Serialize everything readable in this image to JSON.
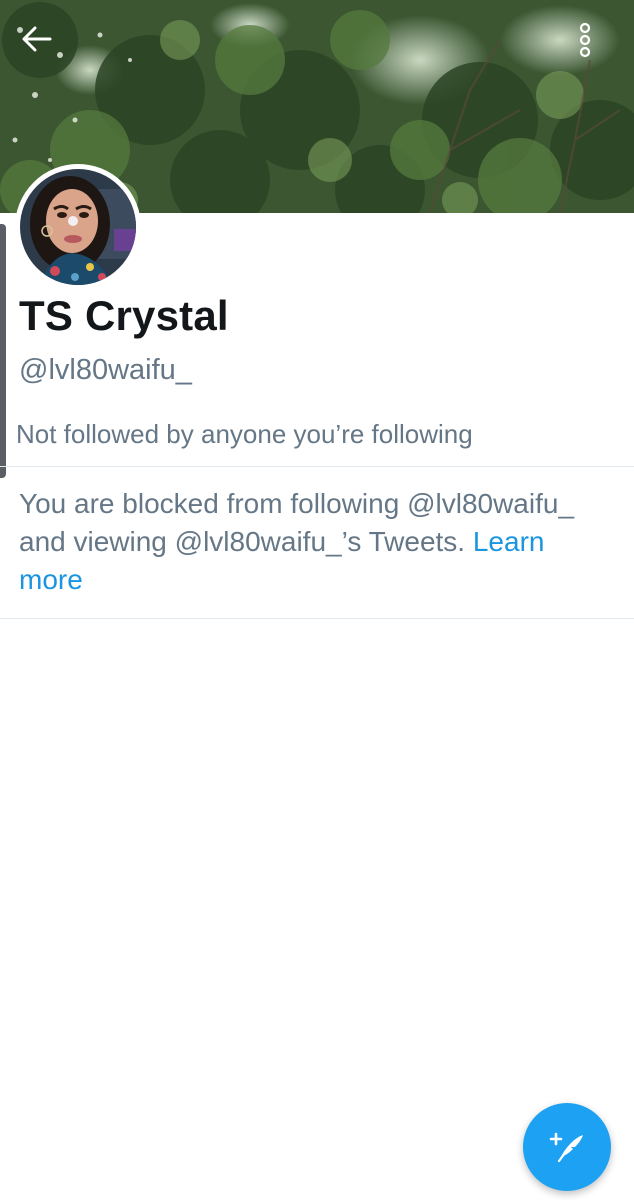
{
  "header": {
    "back_icon": "arrow-left-icon",
    "more_icon": "more-vertical-icon",
    "banner_image": "trees-banner"
  },
  "profile": {
    "display_name": "TS Crystal",
    "handle": "@lvl80waifu_",
    "followed_by_text": "Not followed by anyone you’re following"
  },
  "blocked_notice": {
    "text": "You are blocked from following @lvl80waifu_ and viewing @lvl80waifu_’s Tweets. ",
    "link_label": "Learn more"
  },
  "compose": {
    "icon": "compose-tweet-icon"
  },
  "colors": {
    "accent": "#1da1f2",
    "link": "#1b95e0",
    "primary_text": "#14171a",
    "secondary_text": "#657786",
    "divider": "#e1e8ed"
  }
}
